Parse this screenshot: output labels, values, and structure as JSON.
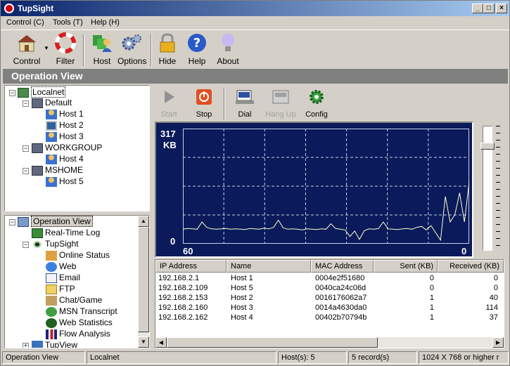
{
  "window": {
    "title": "TupSight"
  },
  "menu": [
    "Control (C)",
    "Tools (T)",
    "Help (H)"
  ],
  "toolbar": {
    "control": "Control",
    "filter": "Filter",
    "host": "Host",
    "options": "Options",
    "hide": "Hide",
    "help": "Help",
    "about": "About"
  },
  "section_title": "Operation View",
  "host_tree": {
    "root": "Localnet",
    "groups": [
      {
        "name": "Default",
        "hosts": [
          "Host 1",
          "Host 2",
          "Host 3"
        ]
      },
      {
        "name": "WORKGROUP",
        "hosts": [
          "Host 4"
        ]
      },
      {
        "name": "MSHOME",
        "hosts": [
          "Host 5"
        ]
      }
    ]
  },
  "nav_tree": {
    "root": "Operation View",
    "items": [
      "Real-Time Log",
      "TupSight",
      "Online Status",
      "Web",
      "Email",
      "FTP",
      "Chat/Game",
      "MSN Transcript",
      "Web Statistics",
      "Flow Analysis",
      "TupView"
    ]
  },
  "capture_toolbar": {
    "start": "Start",
    "stop": "Stop",
    "dial": "Dial",
    "hangup": "Hang Up",
    "config": "Config"
  },
  "graph": {
    "ymax": "317",
    "unit": "KB",
    "ymin": "0",
    "xleft": "60",
    "xright": "0"
  },
  "chart_data": {
    "type": "line",
    "x": [
      60,
      59,
      58,
      57,
      56,
      55,
      54,
      53,
      52,
      51,
      50,
      49,
      48,
      47,
      46,
      45,
      44,
      43,
      42,
      41,
      40,
      39,
      38,
      37,
      36,
      35,
      34,
      33,
      32,
      31,
      30,
      29,
      28,
      27,
      26,
      25,
      24,
      23,
      22,
      21,
      20,
      19,
      18,
      17,
      16,
      15,
      14,
      13,
      12,
      11,
      10,
      9,
      8,
      7,
      6,
      5,
      4,
      3,
      2,
      1,
      0
    ],
    "values": [
      40,
      42,
      41,
      40,
      60,
      45,
      41,
      40,
      41,
      42,
      40,
      41,
      40,
      39,
      42,
      41,
      40,
      43,
      41,
      45,
      65,
      44,
      40,
      41,
      40,
      38,
      41,
      40,
      39,
      41,
      40,
      55,
      42,
      40,
      38,
      20,
      35,
      12,
      36,
      41,
      40,
      42,
      60,
      41,
      40,
      39,
      41,
      42,
      40,
      45,
      48,
      38,
      50,
      30,
      10,
      130,
      60,
      80,
      140,
      60,
      170
    ],
    "ylabel": "KB",
    "ylim": [
      0,
      317
    ],
    "xlim": [
      60,
      0
    ],
    "grid": true
  },
  "table": {
    "columns": [
      "IP Address",
      "Name",
      "MAC Address",
      "Sent (KB)",
      "Received (KB)"
    ],
    "rows": [
      [
        "192.168.2.1",
        "Host 1",
        "0004e2f51680",
        "0",
        "0"
      ],
      [
        "192.168.2.109",
        "Host 5",
        "0040ca24c06d",
        "0",
        "0"
      ],
      [
        "192.168.2.153",
        "Host 2",
        "0016176062a7",
        "1",
        "40"
      ],
      [
        "192.168.2.160",
        "Host 3",
        "0014a4630da0",
        "1",
        "114"
      ],
      [
        "192.168.2.162",
        "Host 4",
        "00402b70794b",
        "1",
        "37"
      ]
    ]
  },
  "statusbar": {
    "view": "Operation View",
    "scope": "Localnet",
    "hosts": "Host(s): 5",
    "records": "5 record(s)",
    "resolution": "1024 X 768 or higher r"
  },
  "colors": {
    "graph_bg": "#0a1a5a",
    "graph_line": "#ffffd0",
    "title_start": "#0a246a",
    "title_end": "#a6caf0"
  }
}
